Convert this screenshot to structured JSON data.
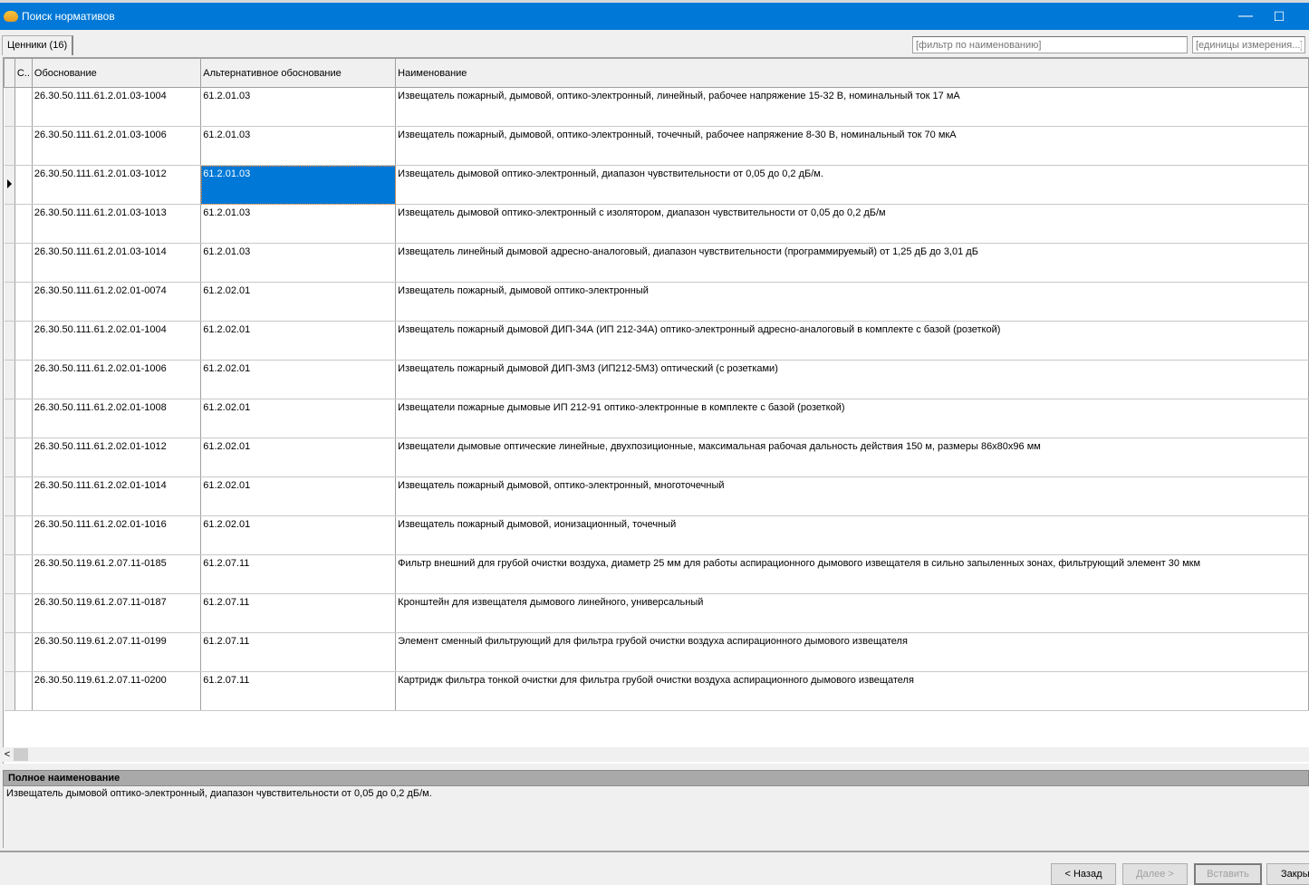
{
  "window": {
    "title": "Поиск нормативов",
    "maximize": "☐"
  },
  "tab": {
    "label": "Ценники (16)"
  },
  "filters": {
    "name_placeholder": "[фильтр по наименованию]",
    "units_placeholder": "[единицы измерения...]"
  },
  "columns": {
    "c": "С..",
    "basis": "Обоснование",
    "alt": "Альтернативное обоснование",
    "name": "Наименование"
  },
  "selected_row": 2,
  "rows": [
    {
      "basis": "26.30.50.111.61.2.01.03-1004",
      "alt": "61.2.01.03",
      "name": "Извещатель пожарный, дымовой, оптико-электронный, линейный, рабочее напряжение 15-32 В, номинальный ток 17 мА"
    },
    {
      "basis": "26.30.50.111.61.2.01.03-1006",
      "alt": "61.2.01.03",
      "name": "Извещатель пожарный, дымовой, оптико-электронный, точечный, рабочее напряжение 8-30 В, номинальный ток 70 мкА"
    },
    {
      "basis": "26.30.50.111.61.2.01.03-1012",
      "alt": "61.2.01.03",
      "name": "Извещатель дымовой оптико-электронный, диапазон чувствительности от 0,05 до 0,2 дБ/м."
    },
    {
      "basis": "26.30.50.111.61.2.01.03-1013",
      "alt": "61.2.01.03",
      "name": "Извещатель дымовой оптико-электронный с изолятором, диапазон чувствительности от 0,05 до 0,2 дБ/м"
    },
    {
      "basis": "26.30.50.111.61.2.01.03-1014",
      "alt": "61.2.01.03",
      "name": "Извещатель линейный дымовой адресно-аналоговый, диапазон чувствительности (программируемый) от 1,25 дБ до 3,01 дБ"
    },
    {
      "basis": "26.30.50.111.61.2.02.01-0074",
      "alt": "61.2.02.01",
      "name": "Извещатель пожарный, дымовой оптико-электронный"
    },
    {
      "basis": "26.30.50.111.61.2.02.01-1004",
      "alt": "61.2.02.01",
      "name": "Извещатель пожарный дымовой ДИП-34А (ИП 212-34А) оптико-электронный адресно-аналоговый в комплекте с базой (розеткой)"
    },
    {
      "basis": "26.30.50.111.61.2.02.01-1006",
      "alt": "61.2.02.01",
      "name": "Извещатель пожарный дымовой ДИП-3М3 (ИП212-5М3) оптический (с розетками)"
    },
    {
      "basis": "26.30.50.111.61.2.02.01-1008",
      "alt": "61.2.02.01",
      "name": "Извещатели пожарные дымовые ИП 212-91 оптико-электронные в комплекте с базой (розеткой)"
    },
    {
      "basis": "26.30.50.111.61.2.02.01-1012",
      "alt": "61.2.02.01",
      "name": "Извещатели дымовые оптические линейные, двухпозиционные, максимальная рабочая дальность действия 150 м, размеры 86х80х96 мм"
    },
    {
      "basis": "26.30.50.111.61.2.02.01-1014",
      "alt": "61.2.02.01",
      "name": "Извещатель пожарный дымовой, оптико-электронный, многоточечный"
    },
    {
      "basis": "26.30.50.111.61.2.02.01-1016",
      "alt": "61.2.02.01",
      "name": "Извещатель пожарный дымовой, ионизационный, точечный"
    },
    {
      "basis": "26.30.50.119.61.2.07.11-0185",
      "alt": "61.2.07.11",
      "name": "Фильтр внешний для грубой очистки воздуха, диаметр 25 мм для работы аспирационного дымового извещателя в сильно запыленных зонах, фильтрующий элемент 30 мкм"
    },
    {
      "basis": "26.30.50.119.61.2.07.11-0187",
      "alt": "61.2.07.11",
      "name": "Кронштейн для извещателя дымового линейного, универсальный"
    },
    {
      "basis": "26.30.50.119.61.2.07.11-0199",
      "alt": "61.2.07.11",
      "name": "Элемент сменный фильтрующий для фильтра грубой очистки воздуха аспирационного дымового извещателя"
    },
    {
      "basis": "26.30.50.119.61.2.07.11-0200",
      "alt": "61.2.07.11",
      "name": "Картридж фильтра тонкой очистки для фильтра грубой очистки воздуха аспирационного дымового извещателя"
    }
  ],
  "scroll_left": "<",
  "detail": {
    "header": "Полное наименование",
    "text": "Извещатель дымовой оптико-электронный, диапазон чувствительности от 0,05 до 0,2 дБ/м."
  },
  "buttons": {
    "back": "< Назад",
    "next": "Далее >",
    "insert": "Вставить",
    "close": "Закрыть"
  }
}
